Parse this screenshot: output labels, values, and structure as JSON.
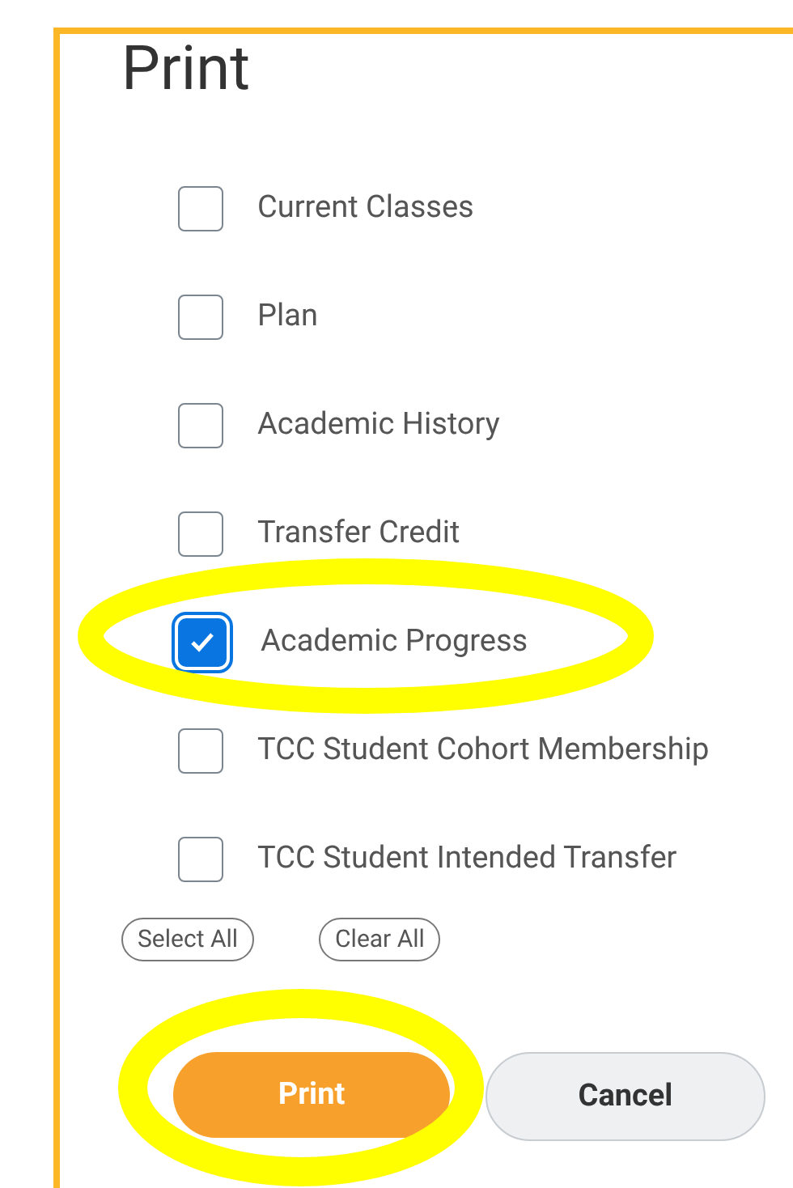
{
  "dialog": {
    "title": "Print"
  },
  "options": [
    {
      "label": "Current Classes",
      "checked": false
    },
    {
      "label": "Plan",
      "checked": false
    },
    {
      "label": "Academic History",
      "checked": false
    },
    {
      "label": "Transfer Credit",
      "checked": false
    },
    {
      "label": "Academic Progress",
      "checked": true
    },
    {
      "label": "TCC Student Cohort Membership",
      "checked": false
    },
    {
      "label": "TCC Student Intended Transfer",
      "checked": false
    }
  ],
  "selection_buttons": [
    "Select All",
    "Clear All"
  ],
  "actions": [
    {
      "label": "Print",
      "kind": "primary"
    },
    {
      "label": "Cancel",
      "kind": "secondary"
    }
  ]
}
